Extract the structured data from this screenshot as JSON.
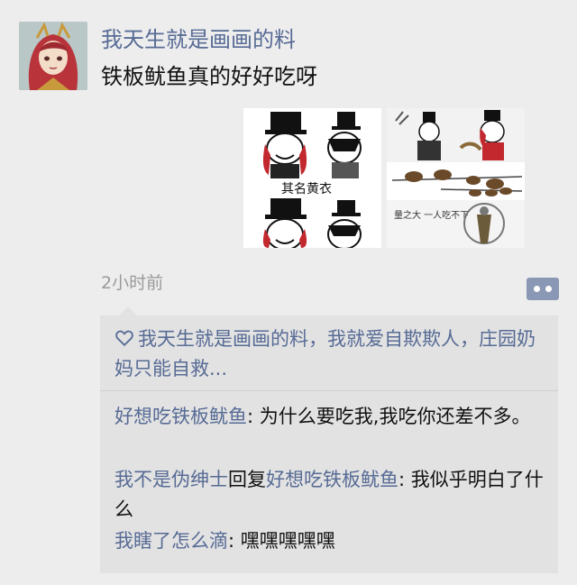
{
  "post": {
    "author": "我天生就是画画的料",
    "text": "铁板鱿鱼真的好好吃呀",
    "time": "2小时前",
    "image_caption": "其名黄衣",
    "image_note": "量之大 一人吃不下"
  },
  "likes": {
    "text": "我天生就是画画的料，我就爱自欺欺人，庄园奶妈只能自救..."
  },
  "comments": [
    {
      "author": "好想吃铁板鱿鱼",
      "sep": ": ",
      "text": "为什么要吃我,我吃你还差不多。"
    },
    {
      "author": "我不是伪绅士",
      "reply_word": "回复",
      "reply_to": "好想吃铁板鱿鱼",
      "sep": ": ",
      "text": "我似乎明白了什么"
    },
    {
      "author": "我瞎了怎么滴",
      "sep": ": ",
      "text": "嘿嘿嘿嘿嘿"
    }
  ],
  "icons": {
    "more": "more-dots-icon",
    "like": "heart-outline-icon"
  },
  "colors": {
    "link": "#576b95",
    "background": "#ededed",
    "panel": "#e2e2e2"
  }
}
